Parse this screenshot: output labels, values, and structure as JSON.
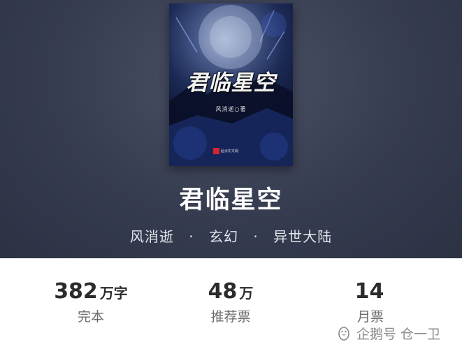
{
  "book": {
    "cover": {
      "title": "君临星空",
      "author_line": "风消逝○著",
      "sub_line": "· · ·",
      "publisher": "起点中文网",
      "accent_color": "#d2262d"
    },
    "title": "君临星空",
    "author": "风消逝",
    "separator": "·",
    "category": "玄幻",
    "subcategory": "异世大陆"
  },
  "stats": [
    {
      "value": "382",
      "unit": "万字",
      "label": "完本"
    },
    {
      "value": "48",
      "unit": "万",
      "label": "推荐票"
    },
    {
      "value": "14",
      "unit": "",
      "label": "月票"
    }
  ],
  "watermark": {
    "text": "企鹅号 仓一卫",
    "icon": "penguin-icon"
  },
  "colors": {
    "hero_background": "#363c4f",
    "title_text": "#ffffff",
    "stat_number": "#2b2b2b",
    "stat_label": "#6b6b6b"
  }
}
